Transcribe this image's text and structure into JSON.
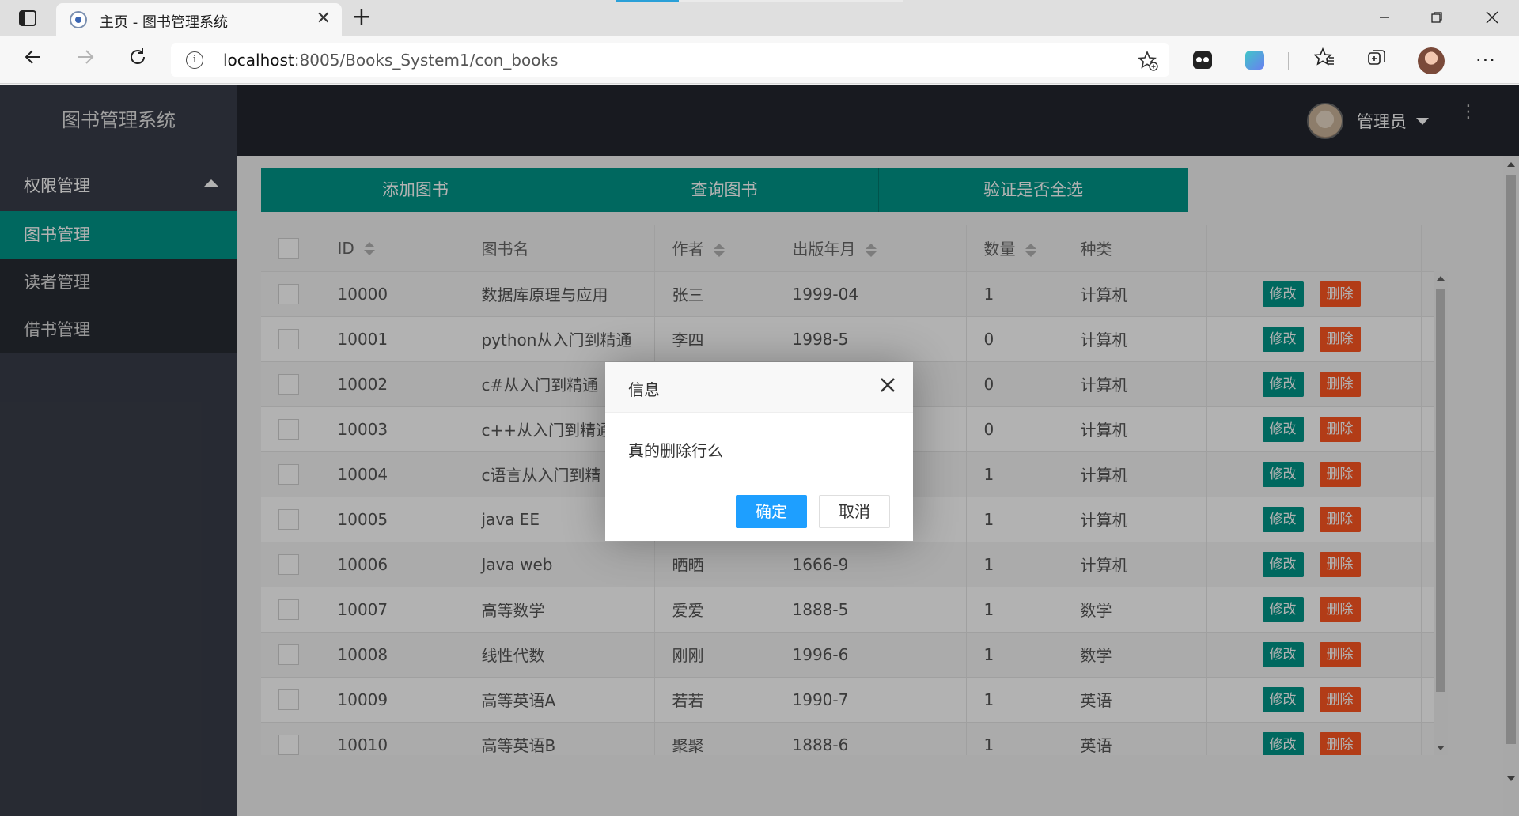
{
  "browser": {
    "tab_title": "主页 - 图书管理系统",
    "tab_close": "✕",
    "new_tab": "+",
    "url_host": "localhost",
    "url_path": ":8005/Books_System1/con_books",
    "icons": [
      "tab-strip-icon",
      "back-icon",
      "forward-icon",
      "refresh-icon",
      "info-icon",
      "add-favorite-icon",
      "extension-icon",
      "copilot-icon",
      "favorites-icon",
      "collections-icon",
      "profile-avatar",
      "more-icon"
    ]
  },
  "sidebar": {
    "logo": "图书管理系统",
    "group_label": "权限管理",
    "items": [
      {
        "label": "图书管理",
        "active": true
      },
      {
        "label": "读者管理",
        "active": false
      },
      {
        "label": "借书管理",
        "active": false
      }
    ]
  },
  "header": {
    "user_name": "管理员",
    "more": "⋮"
  },
  "toolbar": {
    "add_label": "添加图书",
    "query_label": "查询图书",
    "check_all_label": "验证是否全选"
  },
  "table": {
    "columns": [
      "ID",
      "图书名",
      "作者",
      "出版年月",
      "数量",
      "种类"
    ],
    "edit_label": "修改",
    "delete_label": "删除",
    "rows": [
      [
        "10000",
        "数据库原理与应用",
        "张三",
        "1999-04",
        "1",
        "计算机"
      ],
      [
        "10001",
        "python从入门到精通",
        "李四",
        "1998-5",
        "0",
        "计算机"
      ],
      [
        "10002",
        "c#从入门到精通",
        "",
        "",
        "0",
        "计算机"
      ],
      [
        "10003",
        "c++从入门到精通",
        "",
        "",
        "0",
        "计算机"
      ],
      [
        "10004",
        "c语言从入门到精",
        "",
        "",
        "1",
        "计算机"
      ],
      [
        "10005",
        "java EE",
        "",
        "",
        "1",
        "计算机"
      ],
      [
        "10006",
        "Java web",
        "晒晒",
        "1666-9",
        "1",
        "计算机"
      ],
      [
        "10007",
        "高等数学",
        "爱爱",
        "1888-5",
        "1",
        "数学"
      ],
      [
        "10008",
        "线性代数",
        "刚刚",
        "1996-6",
        "1",
        "数学"
      ],
      [
        "10009",
        "高等英语A",
        "若若",
        "1990-7",
        "1",
        "英语"
      ],
      [
        "10010",
        "高等英语B",
        "聚聚",
        "1888-6",
        "1",
        "英语"
      ]
    ]
  },
  "dialog": {
    "title": "信息",
    "message": "真的删除行么",
    "confirm_label": "确定",
    "cancel_label": "取消",
    "close": "✕"
  },
  "colors": {
    "primary": "#009688",
    "danger": "#ff5722",
    "confirm": "#1e9fff",
    "sidebar_bg": "#393d49",
    "header_bg": "#23262e"
  }
}
